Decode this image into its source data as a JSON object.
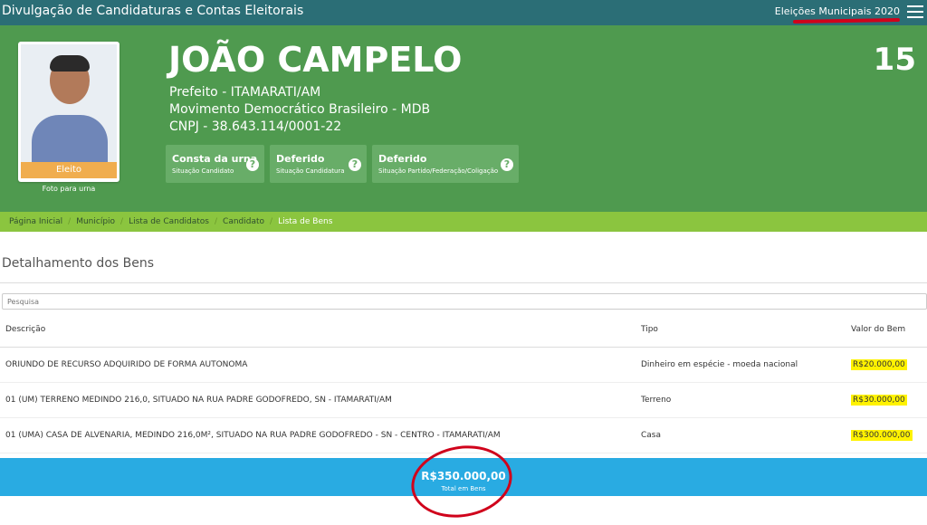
{
  "app": {
    "title": "Divulgação de Candidaturas e Contas Eleitorais",
    "election": "Eleições Municipais 2020"
  },
  "candidate": {
    "name": "JOÃO CAMPELO",
    "number": "15",
    "role": "Prefeito - ITAMARATI/AM",
    "party": "Movimento Democrático Brasileiro - MDB",
    "cnpj": "CNPJ - 38.643.114/0001-22",
    "badge": "Eleito",
    "photo_label": "Foto para urna",
    "statuses": [
      {
        "title": "Consta da urna",
        "subtitle": "Situação Candidato"
      },
      {
        "title": "Deferido",
        "subtitle": "Situação Candidatura"
      },
      {
        "title": "Deferido",
        "subtitle": "Situação Partido/Federação/Coligação"
      }
    ]
  },
  "breadcrumb": [
    "Página Inicial",
    "Município",
    "Lista de Candidatos",
    "Candidato",
    "Lista de Bens"
  ],
  "section": {
    "title": "Detalhamento dos Bens",
    "search_placeholder": "Pesquisa"
  },
  "table": {
    "headers": [
      "Descrição",
      "Tipo",
      "Valor do Bem"
    ],
    "rows": [
      {
        "descricao": "ORIUNDO DE RECURSO ADQUIRIDO DE FORMA AUTONOMA",
        "tipo": "Dinheiro em espécie - moeda nacional",
        "valor": "R$20.000,00"
      },
      {
        "descricao": "01 (UM) TERRENO MEDINDO 216,0, SITUADO NA RUA PADRE GODOFREDO, SN - ITAMARATI/AM",
        "tipo": "Terreno",
        "valor": "R$30.000,00"
      },
      {
        "descricao": "01 (UMA) CASA DE ALVENARIA, MEDINDO 216,0M², SITUADO NA RUA PADRE GODOFREDO - SN - CENTRO - ITAMARATI/AM",
        "tipo": "Casa",
        "valor": "R$300.000,00"
      }
    ]
  },
  "total": {
    "amount": "R$350.000,00",
    "label": "Total em Bens"
  },
  "colors": {
    "topbar": "#2b6e76",
    "hero": "#4f9a4f",
    "breadcrumb": "#8bc53f",
    "total_bar": "#29abe2",
    "annotation": "#d0021b",
    "highlight": "#fff200"
  }
}
